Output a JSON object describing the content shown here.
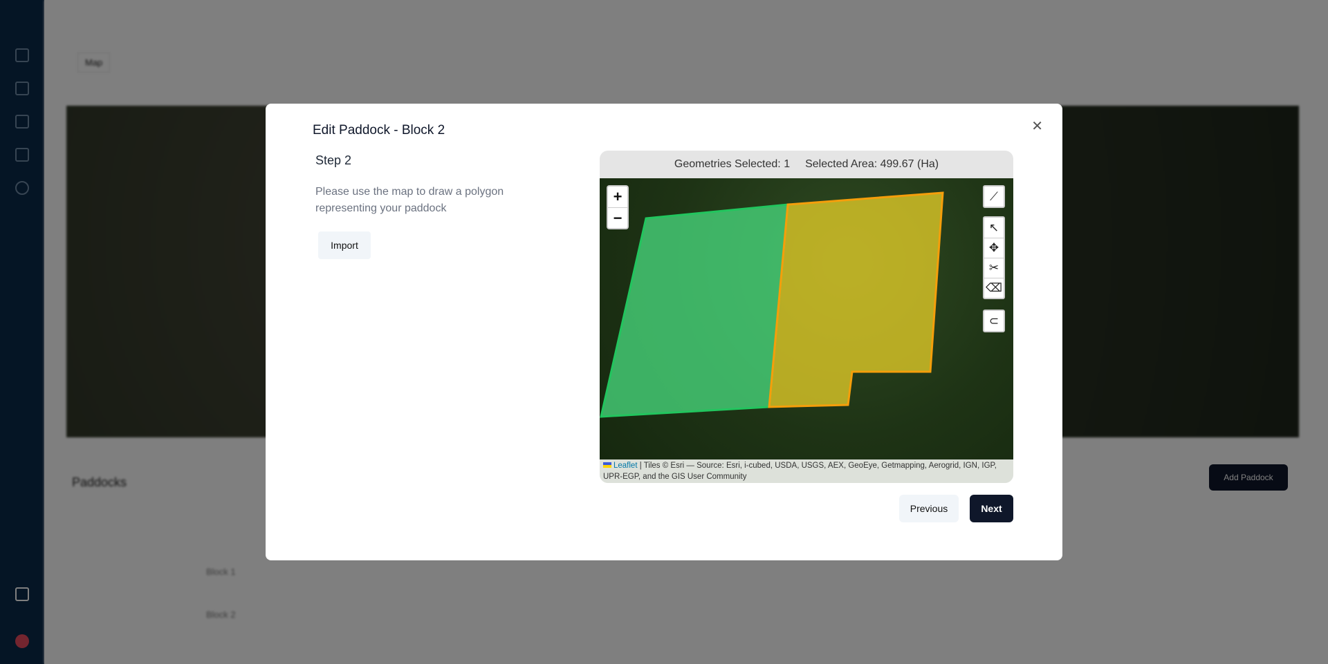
{
  "background": {
    "map_tab": "Map",
    "paddocks_heading": "Paddocks",
    "add_paddock": "Add Paddock",
    "rows": [
      "Block 1",
      "Block 2"
    ]
  },
  "modal": {
    "title": "Edit Paddock - Block 2",
    "close_icon": "close-icon",
    "step": "Step 2",
    "description": "Please use the map to draw a polygon representing your paddock",
    "import_label": "Import",
    "map": {
      "geometries_selected": "Geometries Selected: 1",
      "selected_area": "Selected Area: 499.67 (Ha)",
      "zoom_in": "+",
      "zoom_out": "−",
      "attribution_link": "Leaflet",
      "attribution_text": " | Tiles © Esri — Source: Esri, i-cubed, USDA, USGS, AEX, GeoEye, Getmapping, Aerogrid, IGN, IGP, UPR-EGP, and the GIS User Community",
      "polygon_colors": {
        "existing": "#4ade80",
        "selected": "#eab308"
      }
    },
    "previous_label": "Previous",
    "next_label": "Next"
  }
}
